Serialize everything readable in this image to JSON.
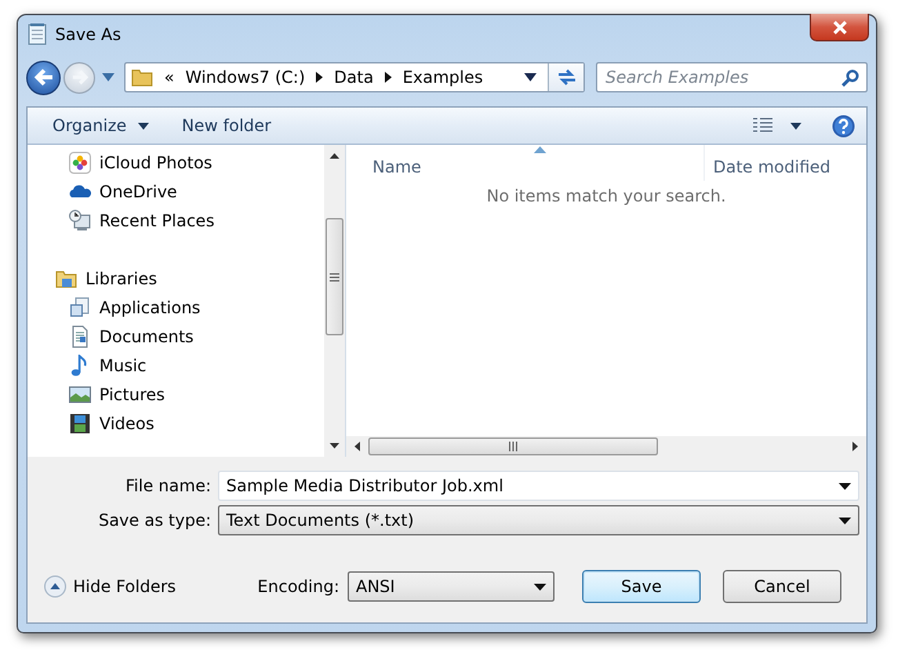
{
  "window": {
    "title": "Save As"
  },
  "address": {
    "segments": [
      "«",
      "Windows7 (C:)",
      "Data",
      "Examples"
    ]
  },
  "search": {
    "placeholder": "Search Examples"
  },
  "toolbar": {
    "organize": "Organize",
    "new_folder": "New folder"
  },
  "sidebar": {
    "sections": [
      {
        "items": [
          {
            "label": "iCloud Photos",
            "kind": "photos"
          },
          {
            "label": "OneDrive",
            "kind": "cloud"
          },
          {
            "label": "Recent Places",
            "kind": "recent"
          }
        ]
      },
      {
        "label": "Libraries",
        "kind": "library",
        "items": [
          {
            "label": "Applications",
            "kind": "applications"
          },
          {
            "label": "Documents",
            "kind": "documents"
          },
          {
            "label": "Music",
            "kind": "music"
          },
          {
            "label": "Pictures",
            "kind": "pictures"
          },
          {
            "label": "Videos",
            "kind": "videos"
          }
        ]
      }
    ]
  },
  "file_list": {
    "columns": [
      "Name",
      "Date modified"
    ],
    "empty_message": "No items match your search."
  },
  "form": {
    "file_name_label": "File name:",
    "file_name": "Sample Media Distributor Job.xml",
    "type_label": "Save as type:",
    "type": "Text Documents (*.txt)"
  },
  "footer": {
    "hide_folders": "Hide Folders",
    "encoding_label": "Encoding:",
    "encoding": "ANSI",
    "buttons": [
      {
        "label": "Save",
        "default": true
      },
      {
        "label": "Cancel",
        "default": false
      }
    ]
  }
}
